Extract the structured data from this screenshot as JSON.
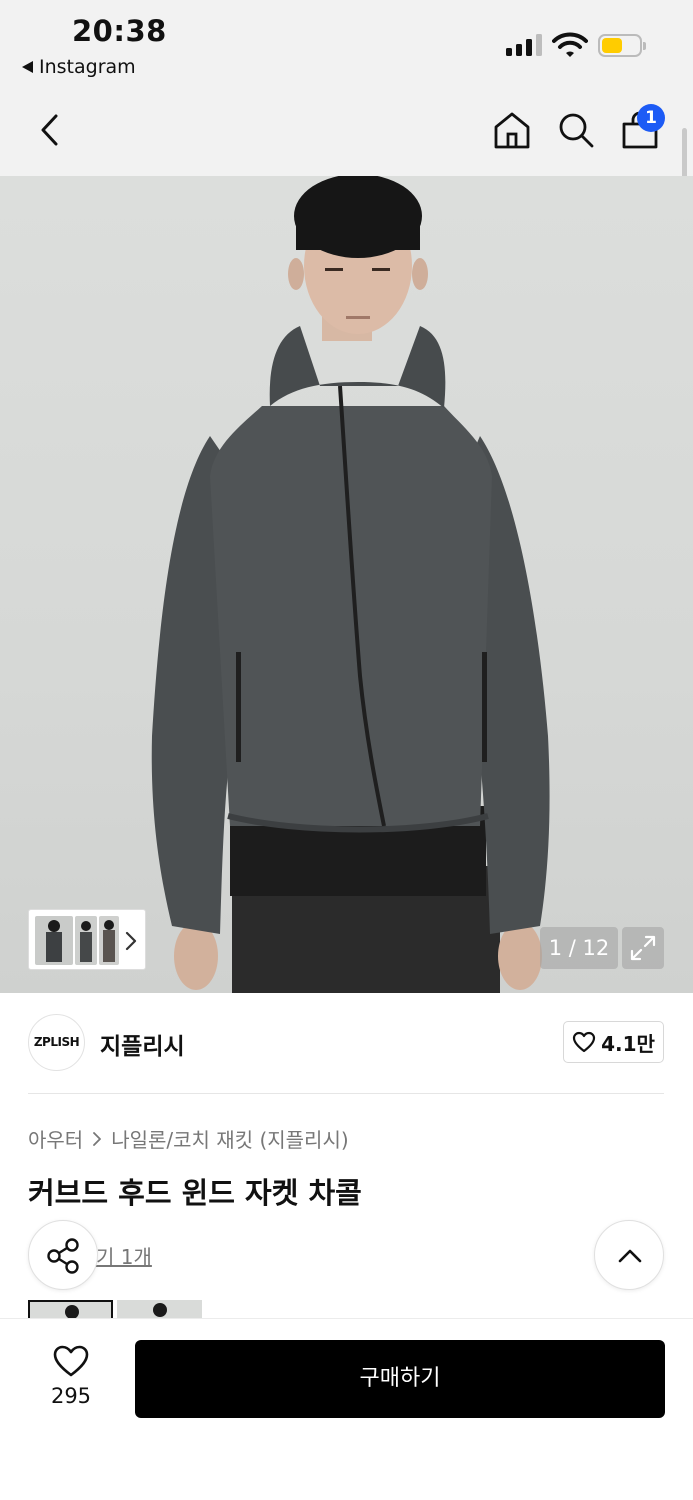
{
  "status_bar": {
    "time": "20:38",
    "back_app": "Instagram",
    "signal": "signal-icon",
    "wifi": "wifi-icon",
    "battery_level": 0.55,
    "battery_color": "#ffcc00"
  },
  "nav": {
    "cart_count": "1",
    "badge_color": "#1d5bf5"
  },
  "gallery": {
    "counter": "1 / 12"
  },
  "brand": {
    "logo_text": "ZPLISH",
    "name": "지플리시",
    "likes": "4.1만"
  },
  "breadcrumb": {
    "level1": "아우터",
    "level2": "나일론/코치 재킷 (지플리시)"
  },
  "product": {
    "title": "커브드 후드 윈드 자켓 차콜",
    "review_link": "기 1개"
  },
  "bottom_bar": {
    "wishlist_count": "295",
    "buy_label": "구매하기"
  }
}
